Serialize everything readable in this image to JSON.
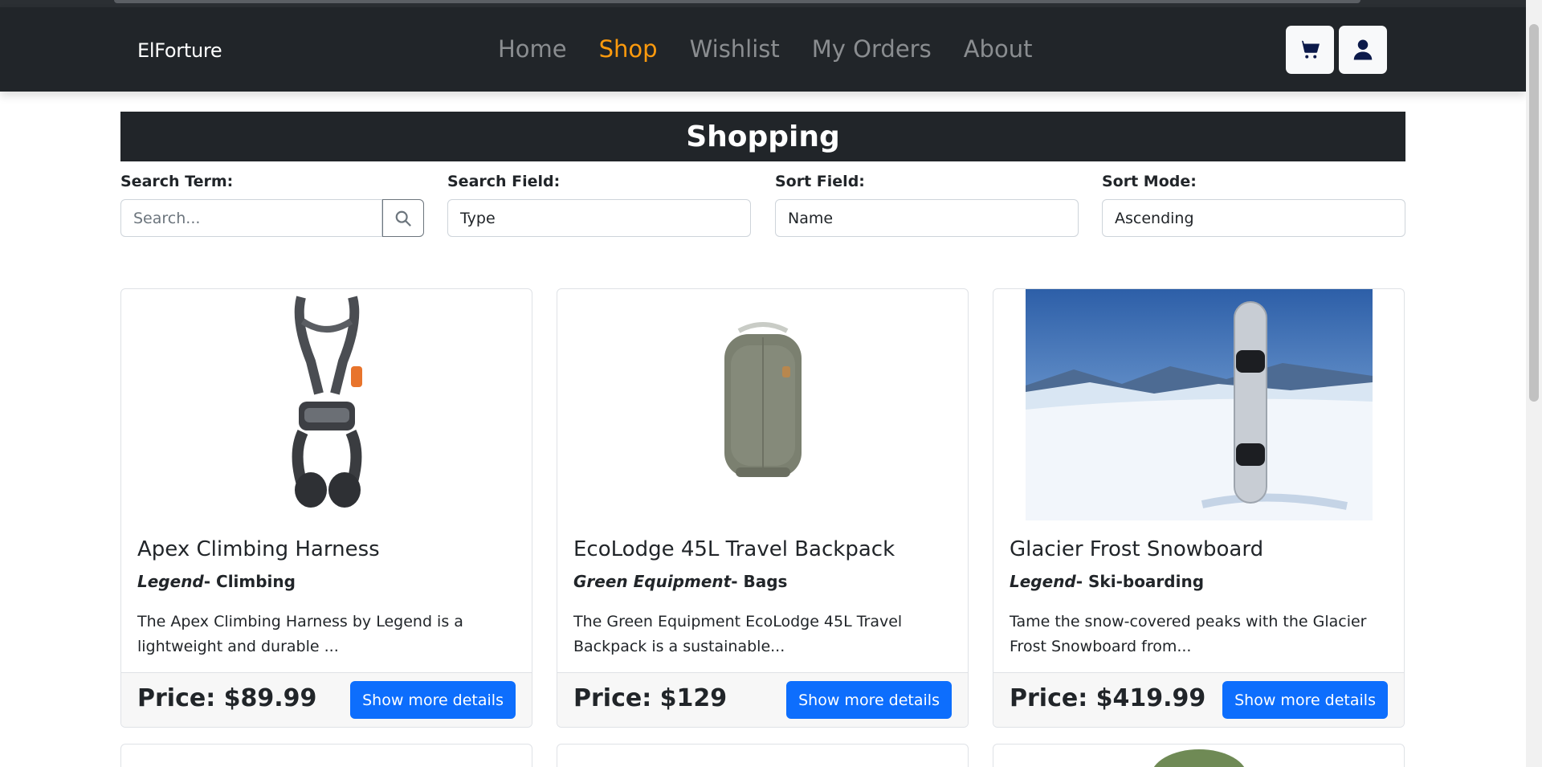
{
  "brand": "ElForture",
  "nav": [
    "Home",
    "Shop",
    "Wishlist",
    "My Orders",
    "About"
  ],
  "active_nav": "Shop",
  "colors": {
    "navbar": "#212529",
    "active": "#fd9a0d",
    "primary_button": "#0d6efd"
  },
  "icons": {
    "cart": "cart-icon",
    "user": "user-icon",
    "search": "search-icon"
  },
  "page_title": "Shopping",
  "filters": {
    "search_term": {
      "label": "Search Term:",
      "placeholder": "Search..."
    },
    "search_field": {
      "label": "Search Field:",
      "value": "Type"
    },
    "sort_field": {
      "label": "Sort Field:",
      "value": "Name"
    },
    "sort_mode": {
      "label": "Sort Mode:",
      "value": "Ascending"
    }
  },
  "products": [
    {
      "name": "Apex Climbing Harness",
      "brand": "Legend",
      "category": "- Climbing",
      "description": "The Apex Climbing Harness by Legend is a lightweight and durable ...",
      "price": "Price: $89.99",
      "button": "Show more details"
    },
    {
      "name": "EcoLodge 45L Travel Backpack",
      "brand": "Green Equipment",
      "category": "- Bags",
      "description": "The Green Equipment EcoLodge 45L Travel Backpack is a sustainable...",
      "price": "Price: $129",
      "button": "Show more details"
    },
    {
      "name": "Glacier Frost Snowboard",
      "brand": "Legend",
      "category": "- Ski-boarding",
      "description": "Tame the snow-covered peaks with the Glacier Frost Snowboard from...",
      "price": "Price: $419.99",
      "button": "Show more details"
    }
  ]
}
